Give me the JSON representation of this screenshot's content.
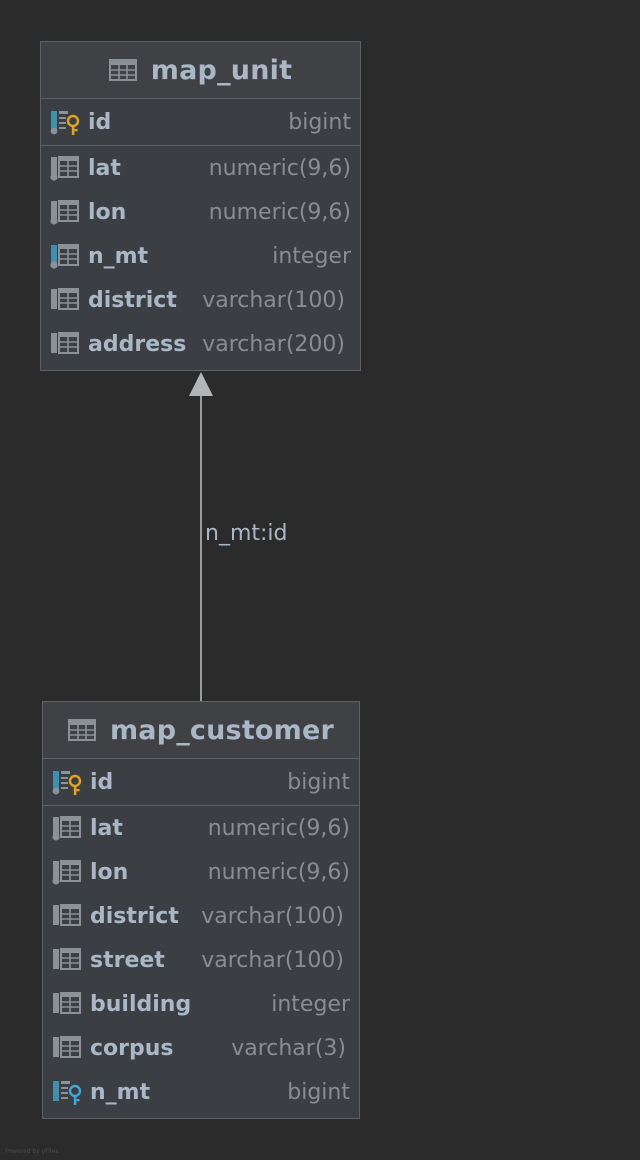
{
  "diagram": {
    "tables": [
      {
        "name": "map_unit",
        "icon": "table-icon",
        "primary_key": {
          "name": "id",
          "type": "bigint",
          "icon": "primary-key-column-icon"
        },
        "columns": [
          {
            "name": "lat",
            "type": "numeric(9,6)",
            "icon": "indexed-column-icon"
          },
          {
            "name": "lon",
            "type": "numeric(9,6)",
            "icon": "indexed-column-icon"
          },
          {
            "name": "n_mt",
            "type": "integer",
            "icon": "indexed-column-icon"
          },
          {
            "name": "district",
            "type": "varchar(100)",
            "icon": "column-icon"
          },
          {
            "name": "address",
            "type": "varchar(200)",
            "icon": "column-icon"
          }
        ]
      },
      {
        "name": "map_customer",
        "icon": "table-icon",
        "primary_key": {
          "name": "id",
          "type": "bigint",
          "icon": "primary-key-column-icon"
        },
        "columns": [
          {
            "name": "lat",
            "type": "numeric(9,6)",
            "icon": "indexed-column-icon"
          },
          {
            "name": "lon",
            "type": "numeric(9,6)",
            "icon": "indexed-column-icon"
          },
          {
            "name": "district",
            "type": "varchar(100)",
            "icon": "column-icon"
          },
          {
            "name": "street",
            "type": "varchar(100)",
            "icon": "column-icon"
          },
          {
            "name": "building",
            "type": "integer",
            "icon": "column-icon"
          },
          {
            "name": "corpus",
            "type": "varchar(3)",
            "icon": "column-icon"
          },
          {
            "name": "n_mt",
            "type": "bigint",
            "icon": "foreign-key-column-icon"
          }
        ]
      }
    ],
    "relationship": {
      "label": "n_mt:id",
      "from": "map_customer",
      "to": "map_unit"
    },
    "watermark": "Powered by yFiles",
    "colors": {
      "background": "#2b2b2b",
      "table_body": "#3b3e42",
      "border": "#5e6063",
      "text": "#a9b7c6",
      "type_text": "#8a8d90",
      "primary_key": "#e0a420",
      "foreign_key": "#3ca7d8",
      "index_marker": "#3f8fb1"
    }
  }
}
